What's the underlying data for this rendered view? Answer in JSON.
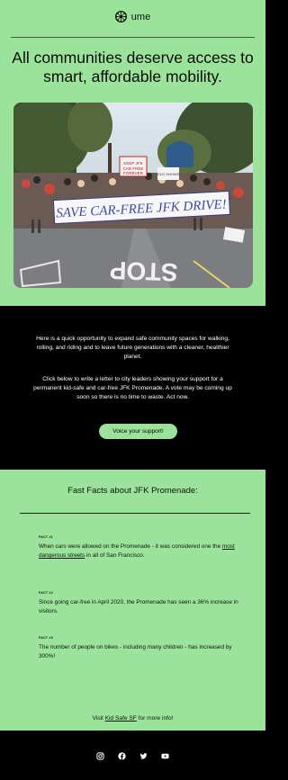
{
  "brand": {
    "name": "ume"
  },
  "hero": {
    "headline": "All communities deserve access to smart, affordable mobility."
  },
  "photo": {
    "banner_text": "SAVE CAR-FREE JFK DRIVE!",
    "sign_left": "KEEP JFK CAR FREE FOREVER",
    "sign_right": "OLD SHOWS",
    "road_text": "STOP"
  },
  "body": {
    "para1": "Here is a quick opportunity to expand safe community spaces for walking, rolling, and riding and to leave future generations with a cleaner, healthier planet.",
    "para2": "Click below to write a letter to city leaders showing your support for a permanent kid-safe and car-free JFK Promenade. A vote may be coming up soon so there is no time to waste. Act now.",
    "cta": "Voice your support!"
  },
  "facts": {
    "title": "Fast Facts about JFK Promenade:",
    "items": [
      {
        "label": "FACT #1",
        "text_before": "When cars were allowed on the Promenade - it was considered one the ",
        "link": "most dangerous streets",
        "text_after": " in all of San Francisco."
      },
      {
        "label": "FACT #2",
        "text": "Since going car-free in April 2020, the Promenade has seen a 36% increase in visitors."
      },
      {
        "label": "FACT #3",
        "text": "The number of people on bikes - including many children - has increased by 300%!"
      }
    ],
    "visit_before": "Visit ",
    "visit_link": "Kid Safe SF",
    "visit_after": " for more info!"
  },
  "social": [
    "instagram-icon",
    "facebook-icon",
    "twitter-icon",
    "youtube-icon"
  ]
}
